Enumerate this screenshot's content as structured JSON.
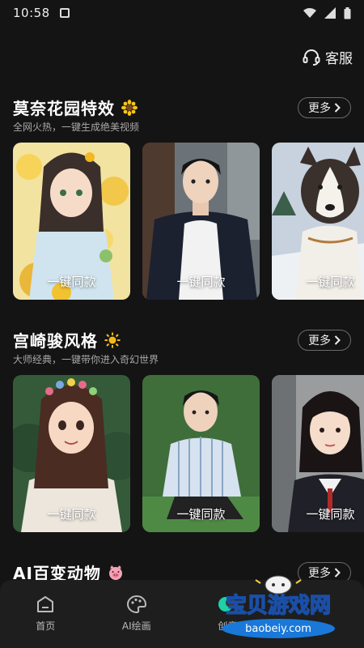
{
  "status": {
    "time": "10:58"
  },
  "header": {
    "service_label": "客服"
  },
  "sections": [
    {
      "title": "莫奈花园特效",
      "subtitle": "全网火热，一键生成绝美视频",
      "more": "更多",
      "cards": [
        {
          "cta": "一键同款"
        },
        {
          "cta": "一键同款"
        },
        {
          "cta": "一键同款"
        }
      ]
    },
    {
      "title": "宫崎骏风格",
      "subtitle": "大师经典，一键带你进入奇幻世界",
      "more": "更多",
      "cards": [
        {
          "cta": "一键同款"
        },
        {
          "cta": "一键同款"
        },
        {
          "cta": "一键同款"
        }
      ]
    },
    {
      "title": "AI百变动物",
      "more": "更多"
    }
  ],
  "tabbar": {
    "tabs": [
      {
        "label": "首页",
        "icon": "home-icon"
      },
      {
        "label": "AI绘画",
        "icon": "palette-icon"
      },
      {
        "label": "创意",
        "icon": "creative-icon"
      }
    ]
  },
  "watermark": {
    "title": "宝贝游戏网",
    "url": "baobeiy.com"
  },
  "colors": {
    "background": "#141414",
    "tabbar": "#1e1e1e",
    "text": "#ffffff",
    "subtext": "#a8a8a8"
  }
}
